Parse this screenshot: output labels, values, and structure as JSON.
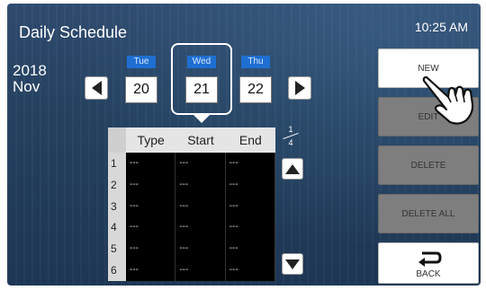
{
  "header": {
    "title": "Daily Schedule",
    "time": "10:25 AM"
  },
  "calendar": {
    "year": "2018",
    "month": "Nov"
  },
  "days": [
    {
      "label": "Tue",
      "date": "20"
    },
    {
      "label": "Wed",
      "date": "21"
    },
    {
      "label": "Thu",
      "date": "22"
    }
  ],
  "page_indicator": {
    "current": "1",
    "total": "4"
  },
  "table": {
    "columns": [
      "Type",
      "Start",
      "End"
    ],
    "rows": [
      {
        "index": "1",
        "type": "---",
        "start": "---",
        "end": "---"
      },
      {
        "index": "2",
        "type": "---",
        "start": "---",
        "end": "---"
      },
      {
        "index": "3",
        "type": "---",
        "start": "---",
        "end": "---"
      },
      {
        "index": "4",
        "type": "---",
        "start": "---",
        "end": "---"
      },
      {
        "index": "5",
        "type": "---",
        "start": "---",
        "end": "---"
      },
      {
        "index": "6",
        "type": "---",
        "start": "---",
        "end": "---"
      }
    ]
  },
  "buttons": {
    "new": "NEW",
    "edit": "EDIT",
    "delete": "DELETE",
    "delete_all": "DELETE ALL",
    "back": "BACK"
  },
  "colors": {
    "background": "#24415f",
    "day_tab": "#1e6fd1",
    "disabled_button": "#7e7e7e"
  }
}
